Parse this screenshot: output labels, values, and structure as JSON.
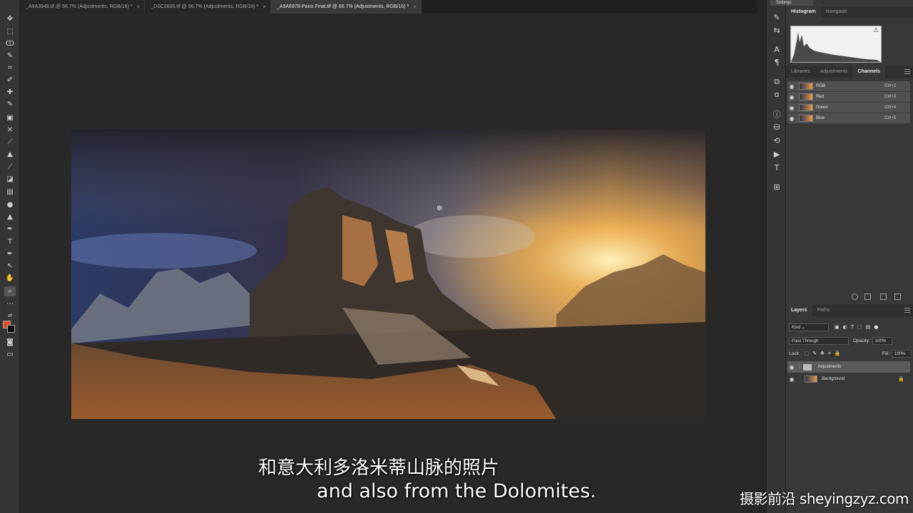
{
  "tabs": [
    {
      "label": "_A9A3948.tif @ 66.7% (Adjustments, RGB/16) *",
      "close": "×",
      "active": false
    },
    {
      "label": "_DSC2635.tif @ 66.7% (Adjustments, RGB/16) *",
      "close": "×",
      "active": false
    },
    {
      "label": "_A9A6978-Pano Final.tif @ 66.7% (Adjustments, RGB/16) *",
      "close": "×",
      "active": true
    }
  ],
  "settings_label": "Settings",
  "panel_top": {
    "tabs": [
      "Histogram",
      "Navigator"
    ],
    "warning_icon": "⚠"
  },
  "panel_mid": {
    "tabs": [
      "Libraries",
      "Adjustments",
      "Channels"
    ],
    "channels": [
      {
        "name": "RGB",
        "shortcut": "Ctrl+2"
      },
      {
        "name": "Red",
        "shortcut": "Ctrl+3"
      },
      {
        "name": "Green",
        "shortcut": "Ctrl+4"
      },
      {
        "name": "Blue",
        "shortcut": "Ctrl+5"
      }
    ]
  },
  "layers_panel": {
    "tabs": [
      "Layers",
      "Paths"
    ],
    "filter": "Kind",
    "blend_mode": "Pass Through",
    "opacity_label": "Opacity:",
    "opacity_value": "100%",
    "lock_label": "Lock:",
    "fill_label": "Fill:",
    "fill_value": "100%",
    "layers": [
      {
        "name": "Adjustments",
        "type": "group",
        "selected": true
      },
      {
        "name": "Background",
        "type": "image",
        "selected": false
      }
    ]
  },
  "subtitle_cn": "和意大利多洛米蒂山脉的照片",
  "subtitle_en": "and also from the Dolomites.",
  "watermark": "摄影前沿 sheyingzyz.com",
  "colors": {
    "foreground": "#e0482a",
    "background": "#0d0d0d",
    "app_bg": "#282828"
  }
}
